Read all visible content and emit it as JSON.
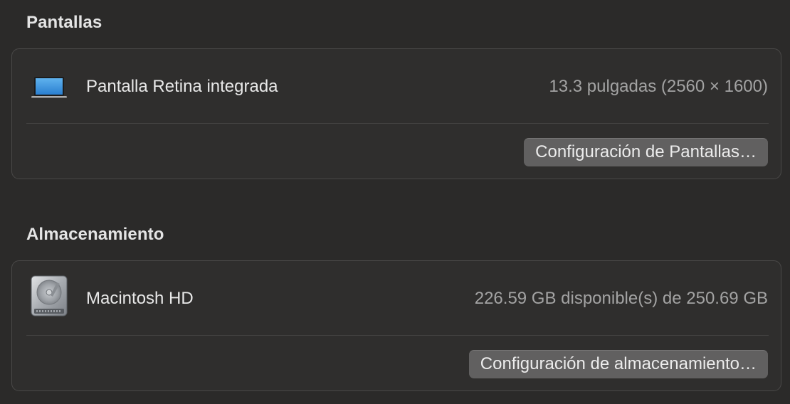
{
  "displays": {
    "section_title": "Pantallas",
    "item": {
      "icon": "laptop-icon",
      "name": "Pantalla Retina integrada",
      "detail": "13.3 pulgadas (2560 × 1600)"
    },
    "button_label": "Configuración de Pantallas…"
  },
  "storage": {
    "section_title": "Almacenamiento",
    "item": {
      "icon": "hard-drive-icon",
      "name": "Macintosh HD",
      "detail": "226.59 GB disponible(s) de 250.69 GB"
    },
    "button_label": "Configuración de almacenamiento…"
  }
}
